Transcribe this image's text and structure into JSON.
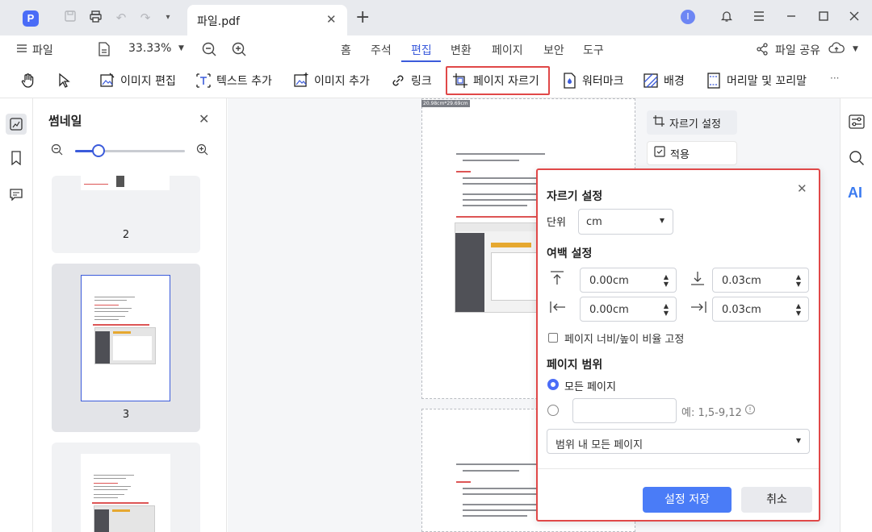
{
  "titlebar": {
    "app_logo": "P",
    "tab_title": "파일.pdf",
    "avatar_letter": "I"
  },
  "menu": {
    "file_label": "파일",
    "zoom_value": "33.33%",
    "tabs": [
      "홈",
      "주석",
      "편집",
      "변환",
      "페이지",
      "보안",
      "도구"
    ],
    "active_tab": "편집",
    "share_label": "파일 공유"
  },
  "toolbar": {
    "items": [
      "이미지 편집",
      "텍스트 추가",
      "이미지 추가",
      "링크",
      "페이지 자르기",
      "워터마크",
      "배경",
      "머리말 및 꼬리말"
    ],
    "more": "···"
  },
  "thumbnails": {
    "title": "썸네일",
    "zoom_level": 0.2,
    "pages": [
      "2",
      "3"
    ]
  },
  "document": {
    "page_size_label": "20.98cm*29.69cm"
  },
  "crop_actions": {
    "settings_label": "자르기 설정",
    "apply_label": "적용"
  },
  "right_strip": {
    "ai_label": "AI"
  },
  "dialog": {
    "title": "자르기 설정",
    "unit_label": "단위",
    "unit_value": "cm",
    "margin_title": "여백 설정",
    "margin_top": "0.00cm",
    "margin_bottom": "0.03cm",
    "margin_left": "0.00cm",
    "margin_right": "0.03cm",
    "lock_ratio_label": "페이지 너비/높이 비율 고정",
    "range_title": "페이지 범위",
    "all_pages_label": "모든 페이지",
    "custom_range_value": "",
    "example_text": "예: 1,5-9,12",
    "subset_value": "범위 내 모든 페이지",
    "save_label": "설정 저장",
    "cancel_label": "취소"
  },
  "colors": {
    "accent": "#3b5bdb",
    "highlight_border": "#e04848",
    "primary_button": "#4a7cf7"
  }
}
